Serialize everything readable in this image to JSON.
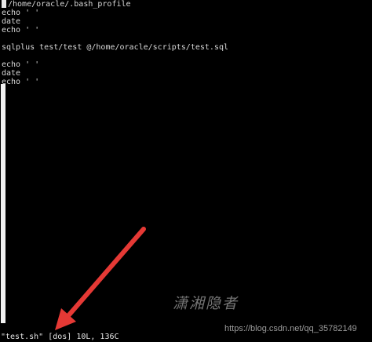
{
  "terminal": {
    "lines": [
      "/home/oracle/.bash_profile",
      "echo ' '",
      "date",
      "echo ' '",
      "",
      "sqlplus test/test @/home/oracle/scripts/test.sql",
      "",
      "echo ' '",
      "date",
      "echo ' '"
    ],
    "status_bar": "\"test.sh\" [dos] 10L, 136C"
  },
  "watermark": {
    "author_mark": "潇湘隐者",
    "url": "https://blog.csdn.net/qq_35782149"
  },
  "annotation": {
    "arrow_color": "#e53935",
    "arrow_icon": "red-arrow-icon"
  }
}
